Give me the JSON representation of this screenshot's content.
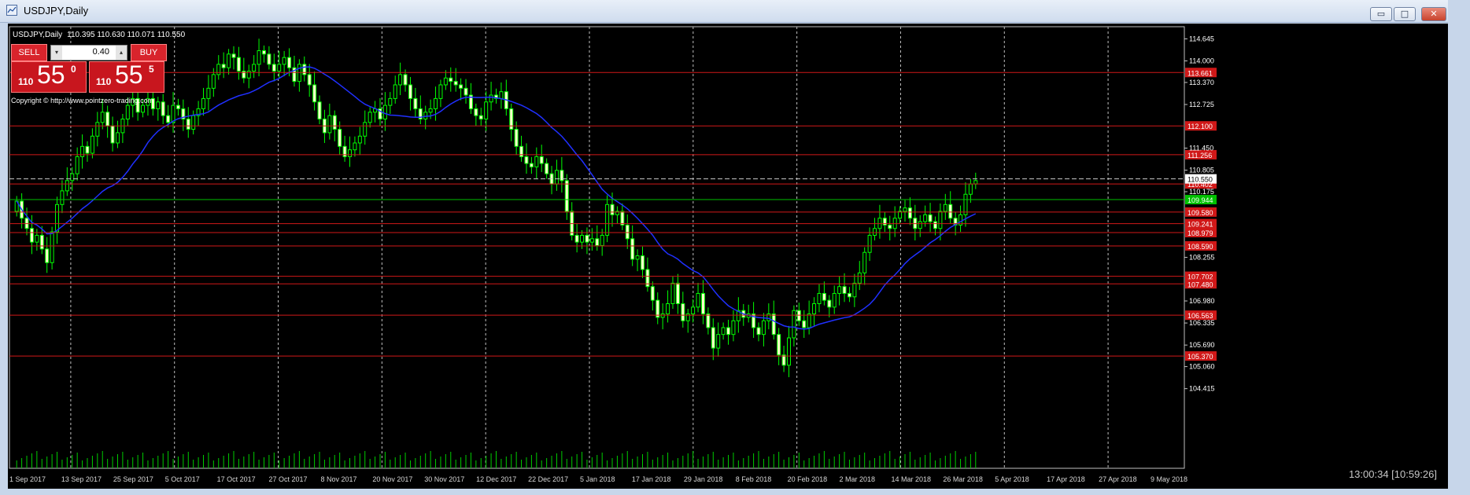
{
  "window": {
    "title": "USDJPY,Daily",
    "controls": {
      "minimize": "▭",
      "maximize": "□",
      "close": "✕"
    }
  },
  "chart_header": {
    "symbol": "USDJPY,Daily",
    "ohlc": "110.395 110.630 110.071 110.550"
  },
  "trade_panel": {
    "sell_label": "SELL",
    "buy_label": "BUY",
    "lot": "0.40",
    "sell_price": {
      "prefix": "110",
      "big": "55",
      "sup": "0"
    },
    "buy_price": {
      "prefix": "110",
      "big": "55",
      "sup": "5"
    }
  },
  "copyright": "Copyright © http://www.pointzero-trading.com",
  "clock": "13:00:34 [10:59:26]",
  "chart_data": {
    "type": "candlestick",
    "symbol": "USDJPY",
    "timeframe": "Daily",
    "ylim": [
      104.2,
      115.0
    ],
    "x_tick_labels": [
      "1 Sep 2017",
      "13 Sep 2017",
      "25 Sep 2017",
      "5 Oct 2017",
      "17 Oct 2017",
      "27 Oct 2017",
      "8 Nov 2017",
      "20 Nov 2017",
      "30 Nov 2017",
      "12 Dec 2017",
      "22 Dec 2017",
      "5 Jan 2018",
      "17 Jan 2018",
      "29 Jan 2018",
      "8 Feb 2018",
      "20 Feb 2018",
      "2 Mar 2018",
      "14 Mar 2018",
      "26 Mar 2018",
      "5 Apr 2018",
      "17 Apr 2018",
      "27 Apr 2018",
      "9 May 2018"
    ],
    "y_tick_labels": [
      "114.645",
      "114.000",
      "113.370",
      "112.725",
      "111.450",
      "110.805",
      "110.175",
      "108.255",
      "106.980",
      "106.335",
      "105.690",
      "105.060",
      "104.415"
    ],
    "price_lines": [
      {
        "value": 113.661,
        "label": "113.661"
      },
      {
        "value": 112.1,
        "label": "112.100"
      },
      {
        "value": 111.256,
        "label": "111.256"
      },
      {
        "value": 110.402,
        "label": "110.402"
      },
      {
        "value": 109.944,
        "label": "109.944",
        "color": "green"
      },
      {
        "value": 109.58,
        "label": "109.580"
      },
      {
        "value": 109.241,
        "label": "109.241"
      },
      {
        "value": 108.979,
        "label": "108.979"
      },
      {
        "value": 108.59,
        "label": "108.590"
      },
      {
        "value": 107.702,
        "label": "107.702"
      },
      {
        "value": 107.48,
        "label": "107.480"
      },
      {
        "value": 106.563,
        "label": "106.563"
      },
      {
        "value": 105.37,
        "label": "105.370"
      }
    ],
    "current_price": {
      "value": 110.55,
      "label": "110.550"
    },
    "closes": [
      109.9,
      109.4,
      109.1,
      108.7,
      108.9,
      108.5,
      108.1,
      109.0,
      109.8,
      110.2,
      110.5,
      110.7,
      111.2,
      111.5,
      111.3,
      111.8,
      112.2,
      112.5,
      112.1,
      111.6,
      111.9,
      112.3,
      112.7,
      112.9,
      112.5,
      112.7,
      112.9,
      112.6,
      112.8,
      112.4,
      112.2,
      112.7,
      112.6,
      112.3,
      112.0,
      112.4,
      112.6,
      112.9,
      113.2,
      113.6,
      113.9,
      113.8,
      114.2,
      114.1,
      113.7,
      113.5,
      113.7,
      113.9,
      114.3,
      114.2,
      113.9,
      113.7,
      113.9,
      114.1,
      113.8,
      113.4,
      113.9,
      113.6,
      113.3,
      112.8,
      112.3,
      111.9,
      112.4,
      112.0,
      111.5,
      111.2,
      111.4,
      111.6,
      111.8,
      112.2,
      112.5,
      112.6,
      112.3,
      112.7,
      112.9,
      113.3,
      113.6,
      113.3,
      112.9,
      112.6,
      112.3,
      112.5,
      112.6,
      112.9,
      113.3,
      113.5,
      113.4,
      113.3,
      113.2,
      113.0,
      112.6,
      112.4,
      112.3,
      112.8,
      113.0,
      112.9,
      113.1,
      112.6,
      112.0,
      111.5,
      111.2,
      111.0,
      110.9,
      111.2,
      111.0,
      110.7,
      110.4,
      110.8,
      110.5,
      109.6,
      108.9,
      108.7,
      108.9,
      108.7,
      108.8,
      108.6,
      108.9,
      109.8,
      109.5,
      109.6,
      109.2,
      108.8,
      108.2,
      108.3,
      107.9,
      107.4,
      107.0,
      106.5,
      106.6,
      106.9,
      107.5,
      106.9,
      106.4,
      106.6,
      106.8,
      107.2,
      106.6,
      106.2,
      105.6,
      106.0,
      106.2,
      106.0,
      106.4,
      106.7,
      106.5,
      106.6,
      106.2,
      106.0,
      106.4,
      106.6,
      106.0,
      105.4,
      105.1,
      105.9,
      106.7,
      106.4,
      106.2,
      106.6,
      106.9,
      107.2,
      107.0,
      106.8,
      107.2,
      107.4,
      107.2,
      107.1,
      107.5,
      107.8,
      108.4,
      108.9,
      109.1,
      109.4,
      109.2,
      109.1,
      109.4,
      109.6,
      109.7,
      109.4,
      109.1,
      109.3,
      109.5,
      109.3,
      109.1,
      109.6,
      109.8,
      109.4,
      109.2,
      109.5,
      110.1,
      110.4,
      110.5
    ],
    "moving_average": {
      "color": "blue",
      "period": 20
    }
  }
}
